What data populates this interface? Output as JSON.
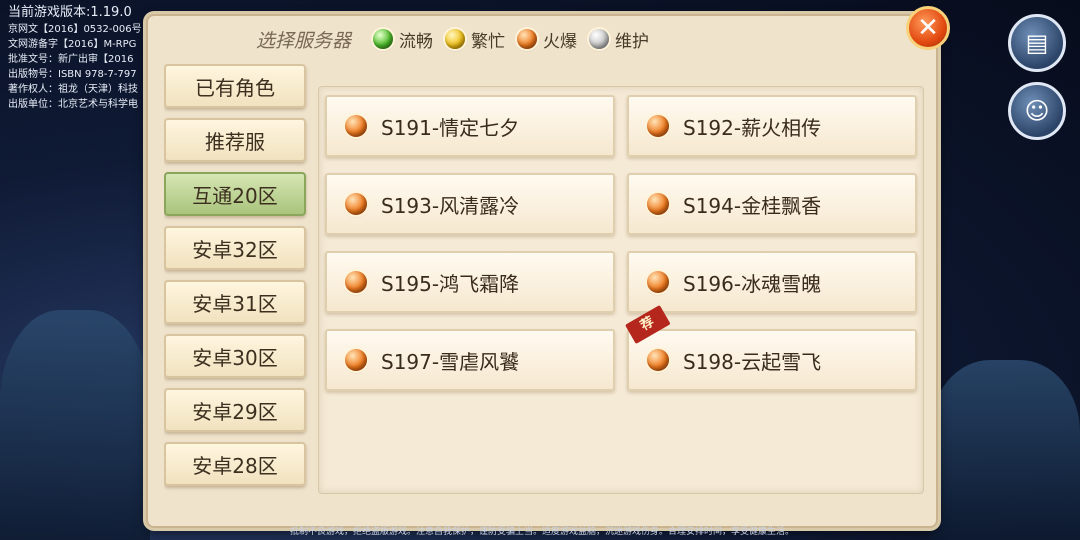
{
  "info": {
    "version": "当前游戏版本:1.19.0",
    "lines": [
      "京网文【2016】0532-006号",
      "文网游备字【2016】M-RPG",
      "批准文号：新广出审【2016",
      "出版物号：ISBN 978-7-797",
      "著作权人：祖龙（天津）科技",
      "出版单位：北京艺术与科学电"
    ]
  },
  "header": {
    "title": "选择服务器",
    "legend": [
      {
        "label": "流畅",
        "color": "green"
      },
      {
        "label": "繁忙",
        "color": "yellow"
      },
      {
        "label": "火爆",
        "color": "orange"
      },
      {
        "label": "维护",
        "color": "gray"
      }
    ]
  },
  "sidebar": {
    "items": [
      {
        "label": "已有角色",
        "active": false
      },
      {
        "label": "推荐服",
        "active": false
      },
      {
        "label": "互通20区",
        "active": true
      },
      {
        "label": "安卓32区",
        "active": false
      },
      {
        "label": "安卓31区",
        "active": false
      },
      {
        "label": "安卓30区",
        "active": false
      },
      {
        "label": "安卓29区",
        "active": false
      },
      {
        "label": "安卓28区",
        "active": false
      }
    ]
  },
  "servers": [
    {
      "label": "S191-情定七夕",
      "status": "orange",
      "badge": ""
    },
    {
      "label": "S192-薪火相传",
      "status": "orange",
      "badge": ""
    },
    {
      "label": "S193-风清露冷",
      "status": "orange",
      "badge": ""
    },
    {
      "label": "S194-金桂飘香",
      "status": "orange",
      "badge": ""
    },
    {
      "label": "S195-鸿飞霜降",
      "status": "orange",
      "badge": ""
    },
    {
      "label": "S196-冰魂雪魄",
      "status": "orange",
      "badge": ""
    },
    {
      "label": "S197-雪虐风饕",
      "status": "orange",
      "badge": ""
    },
    {
      "label": "S198-云起雪飞",
      "status": "orange",
      "badge": "荐"
    }
  ],
  "bottom_tip": "抵制不良游戏，拒绝盗版游戏。注意自我保护，谨防受骗上当。适度游戏益脑，沉迷游戏伤身。合理安排时间，享受健康生活。",
  "icons": {
    "close": "close-icon",
    "notice": "notice-icon",
    "account": "account-icon"
  }
}
